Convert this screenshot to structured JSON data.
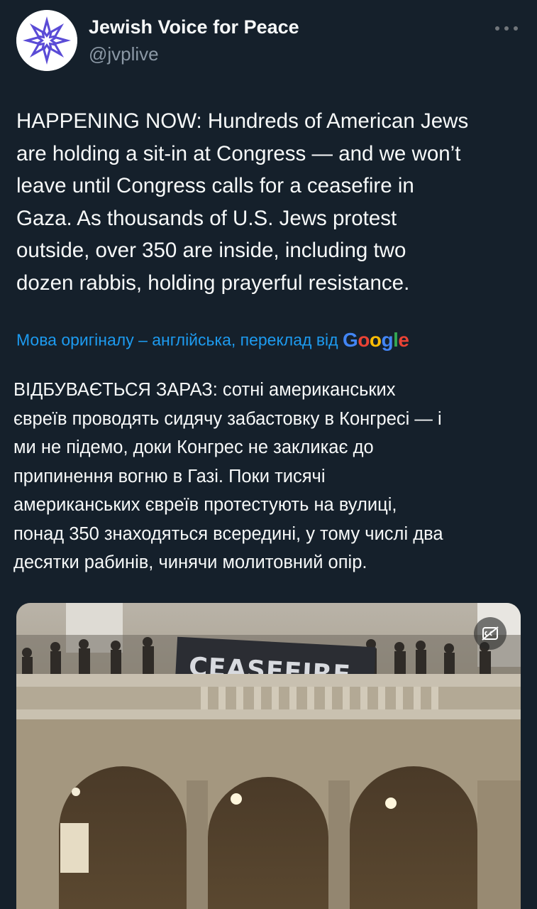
{
  "author": {
    "name": "Jewish Voice for Peace",
    "handle": "@jvplive",
    "avatar_icon": "eight-point-star-logo-icon"
  },
  "menu": {
    "more_icon": "more-horizontal-icon"
  },
  "tweet": {
    "text_original": "HAPPENING NOW: Hundreds of American Jews\nare holding a sit-in at Congress — and we won’t\nleave until Congress calls for a ceasefire in\nGaza. As thousands of U.S. Jews protest\noutside, over 350 are inside, including two\ndozen rabbis, holding prayerful resistance.",
    "translation_label": "Мова оригіналу – англійська, переклад від",
    "translation_provider": "Google",
    "text_translated": "ВІДБУВАЄТЬСЯ ЗАРАЗ: сотні американських\nєвреїв проводять сидячу забастовку в Конгресі — і\nми не підемо, доки Конгрес не закликає до\nприпинення вогню в Газі. Поки тисячі\nамериканських євреїв протестують на вулиці,\nпонад 350 знаходяться всередині, у тому числі два\nдесятки рабинів, чинячи молитовний опір."
  },
  "media": {
    "banner_text": "CEASEFIRE.",
    "badge_icon": "closed-captions-off-icon"
  },
  "colors": {
    "background": "#15202b",
    "text_primary": "#f7f9f9",
    "text_secondary": "#8b98a5",
    "link": "#1d9bf0",
    "avatar_purple": "#5a4bd6"
  }
}
